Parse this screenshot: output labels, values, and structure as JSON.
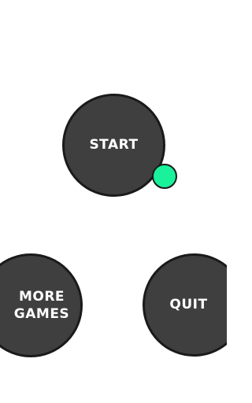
{
  "menu": {
    "start_label": "START",
    "more_games_label": "MORE\nGAMES",
    "quit_label": "QUIT"
  },
  "colors": {
    "background": "#ffffff",
    "button_fill": "#3f3f3f",
    "button_border": "#1a1a1a",
    "ball": "#19f29a"
  }
}
